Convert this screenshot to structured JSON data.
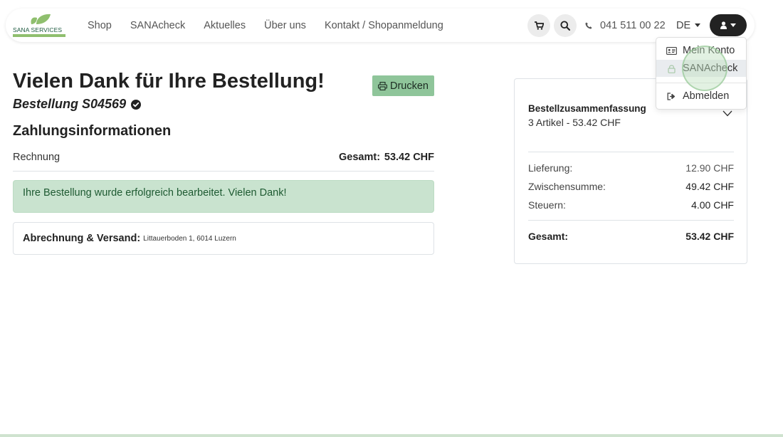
{
  "brand": {
    "logo_text": "SANA SERVICES"
  },
  "nav": {
    "links": [
      "Shop",
      "SANAcheck",
      "Aktuelles",
      "Über uns",
      "Kontakt / Shopanmeldung"
    ],
    "phone": "041 511 00 22",
    "language": "DE"
  },
  "account_menu": {
    "items": [
      {
        "label": "Mein Konto",
        "icon": "id-card-icon"
      },
      {
        "label": "SANAcheck",
        "icon": "lock-icon"
      },
      {
        "label": "Abmelden",
        "icon": "sign-out-icon"
      }
    ]
  },
  "order": {
    "title": "Vielen Dank für Ihre Bestellung!",
    "number": "Bestellung S04569",
    "print_label": "Drucken"
  },
  "payment": {
    "section_title": "Zahlungsinformationen",
    "method": "Rechnung",
    "total_label": "Gesamt:",
    "total_value": "53.42 CHF",
    "success_message": "Ihre Bestellung wurde erfolgreich bearbeitet. Vielen Dank!",
    "address_label": "Abrechnung & Versand:",
    "address_value": "Littauerboden 1, 6014 Luzern"
  },
  "summary": {
    "title": "Bestellzusammenfassung",
    "subtitle": "3 Artikel -  53.42 CHF",
    "delivery_label": "Lieferung:",
    "delivery_value": "12.90 CHF",
    "subtotal_label": "Zwischensumme:",
    "subtotal_value": "49.42 CHF",
    "tax_label": "Steuern:",
    "tax_value": "4.00 CHF",
    "total_label": "Gesamt:",
    "total_value": "53.42 CHF"
  },
  "colors": {
    "brand_green": "#8fbf6e",
    "button_green": "#8fc59a",
    "alert_bg": "#c9e3cf",
    "account_button": "#222222"
  }
}
